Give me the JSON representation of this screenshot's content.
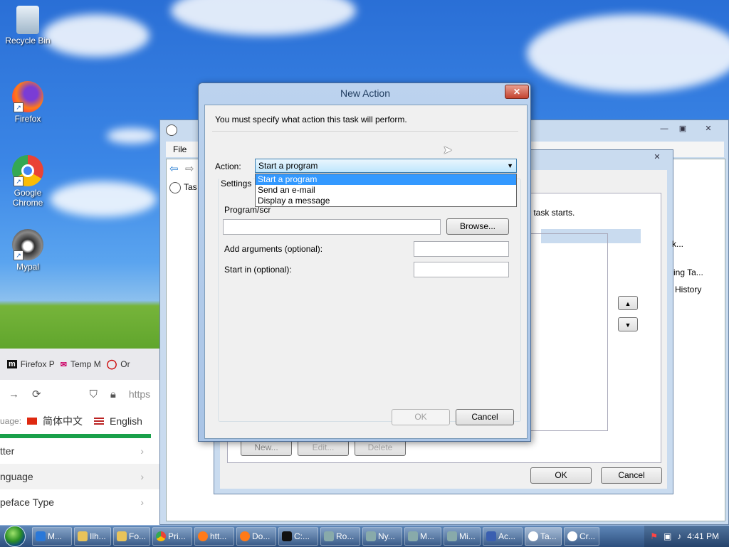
{
  "desktop": {
    "icons": [
      {
        "label": "Recycle Bin"
      },
      {
        "label": "Firefox"
      },
      {
        "label": "Google Chrome"
      },
      {
        "label": "Mypal"
      }
    ]
  },
  "browser": {
    "tabs": [
      "Firefox P",
      "Temp M",
      "Or"
    ],
    "url_text": "https",
    "language_label": "uage:",
    "lang_options": [
      "简体中文",
      "English"
    ],
    "menu_items": [
      "tter",
      "nguage",
      "peface Type"
    ]
  },
  "task_scheduler": {
    "menu_file": "File",
    "tree_item": "Tas",
    "side_text_1": "r task starts.",
    "side_text_2": "k...",
    "side_text_3": "ing Ta...",
    "side_text_4": "History",
    "new_button": "New...",
    "edit_button": "Edit...",
    "delete_button": "Delete"
  },
  "properties": {
    "ok": "OK",
    "cancel": "Cancel"
  },
  "new_action": {
    "title": "New Action",
    "instruction": "You must specify what action this task will perform.",
    "action_label": "Action:",
    "action_value": "Start a program",
    "options": [
      "Start a program",
      "Send an e-mail",
      "Display a message"
    ],
    "settings_label": "Settings",
    "program_label": "Program/scr",
    "program_value": "",
    "browse": "Browse...",
    "arguments_label": "Add arguments (optional):",
    "arguments_value": "",
    "start_in_label": "Start in (optional):",
    "start_in_value": "",
    "ok": "OK",
    "cancel": "Cancel"
  },
  "taskbar": {
    "buttons": [
      "M...",
      "Ilh...",
      "Fo...",
      "Pri...",
      "htt...",
      "Do...",
      "C:...",
      "Ro...",
      "Ny...",
      "M...",
      "Mi...",
      "Ac...",
      "Ta...",
      "Cr..."
    ],
    "clock": "4:41 PM"
  }
}
